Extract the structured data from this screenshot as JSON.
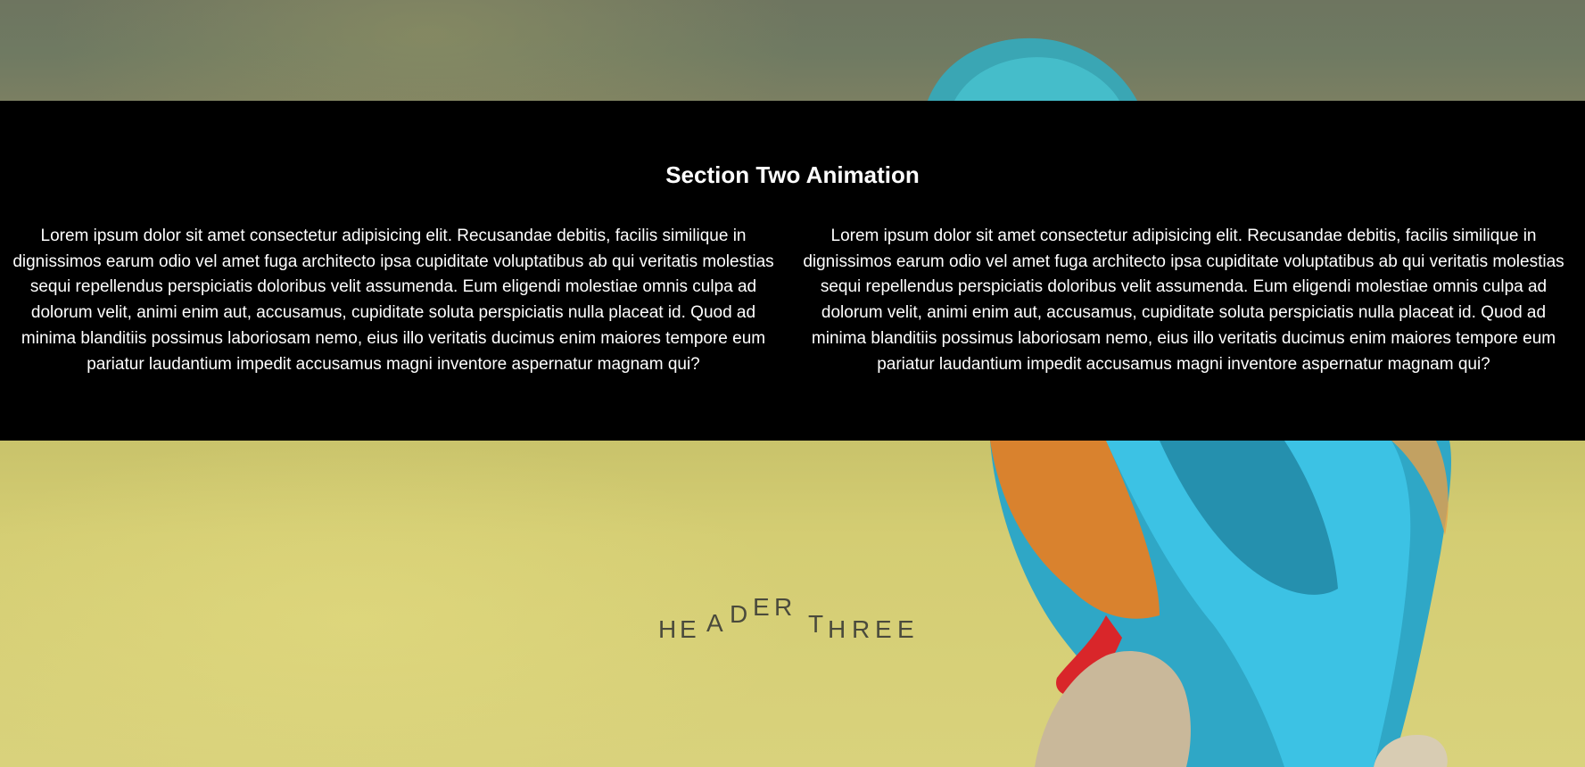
{
  "section_two": {
    "title": "Section Two Animation",
    "paragraph_left": "Lorem ipsum dolor sit amet consectetur adipisicing elit. Recusandae debitis, facilis similique in dignissimos earum odio vel amet fuga architecto ipsa cupiditate voluptatibus ab qui veritatis molestias sequi repellendus perspiciatis doloribus velit assumenda. Eum eligendi molestiae omnis culpa ad dolorum velit, animi enim aut, accusamus, cupiditate soluta perspiciatis nulla placeat id. Quod ad minima blanditiis possimus laboriosam nemo, eius illo veritatis ducimus enim maiores tempore eum pariatur laudantium impedit accusamus magni inventore aspernatur magnam qui?",
    "paragraph_right": "Lorem ipsum dolor sit amet consectetur adipisicing elit. Recusandae debitis, facilis similique in dignissimos earum odio vel amet fuga architecto ipsa cupiditate voluptatibus ab qui veritatis molestias sequi repellendus perspiciatis doloribus velit assumenda. Eum eligendi molestiae omnis culpa ad dolorum velit, animi enim aut, accusamus, cupiditate soluta perspiciatis nulla placeat id. Quod ad minima blanditiis possimus laboriosam nemo, eius illo veritatis ducimus enim maiores tempore eum pariatur laudantium impedit accusamus magni inventore aspernatur magnam qui?"
  },
  "header_three": {
    "letters": [
      "H",
      "E",
      "A",
      "D",
      "E",
      "R",
      "T",
      "H",
      "R",
      "E",
      "E"
    ]
  },
  "colors": {
    "band": "#000000",
    "band_text": "#ffffff",
    "header_text": "#4a4a3c"
  }
}
